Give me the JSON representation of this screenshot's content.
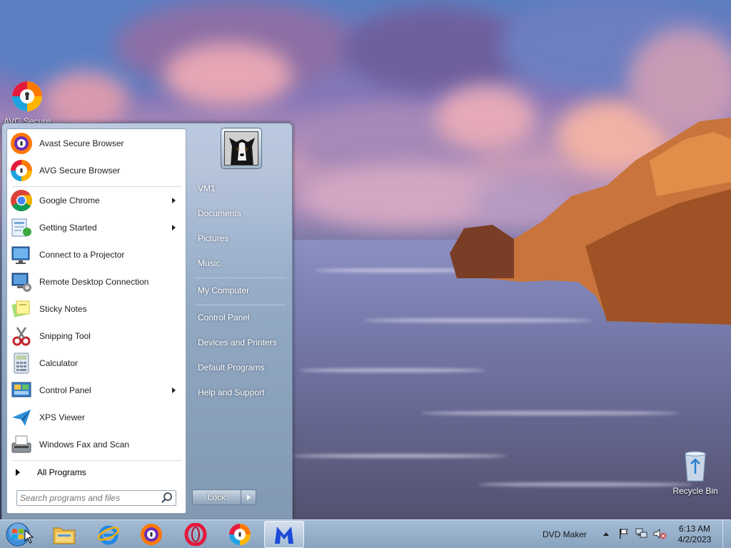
{
  "desktop": {
    "icons": [
      {
        "label": "AVG Secure"
      },
      {
        "label": "Recycle Bin"
      }
    ]
  },
  "start_menu": {
    "pinned_programs": [
      {
        "label": "Avast Secure Browser",
        "icon": "avast-browser-icon",
        "submenu": false
      },
      {
        "label": "AVG Secure Browser",
        "icon": "avg-browser-icon",
        "submenu": false
      }
    ],
    "recent_programs": [
      {
        "label": "Google Chrome",
        "icon": "chrome-icon",
        "submenu": true
      },
      {
        "label": "Getting Started",
        "icon": "getting-started-icon",
        "submenu": true
      },
      {
        "label": "Connect to a Projector",
        "icon": "projector-icon",
        "submenu": false
      },
      {
        "label": "Remote Desktop Connection",
        "icon": "remote-desktop-icon",
        "submenu": false
      },
      {
        "label": "Sticky Notes",
        "icon": "sticky-notes-icon",
        "submenu": false
      },
      {
        "label": "Snipping Tool",
        "icon": "snipping-tool-icon",
        "submenu": false
      },
      {
        "label": "Calculator",
        "icon": "calculator-icon",
        "submenu": false
      },
      {
        "label": "Control Panel",
        "icon": "control-panel-icon",
        "submenu": true
      },
      {
        "label": "XPS Viewer",
        "icon": "xps-viewer-icon",
        "submenu": false
      },
      {
        "label": "Windows Fax and Scan",
        "icon": "fax-scan-icon",
        "submenu": false
      }
    ],
    "all_programs_label": "All Programs",
    "search_placeholder": "Search programs and files",
    "right_links": [
      {
        "label": "VM1"
      },
      {
        "label": "Documents"
      },
      {
        "label": "Pictures"
      },
      {
        "label": "Music"
      },
      {
        "label": "My Computer"
      },
      {
        "label": "Control Panel"
      },
      {
        "label": "Devices and Printers"
      },
      {
        "label": "Default Programs"
      },
      {
        "label": "Help and Support"
      }
    ],
    "lock_label": "Lock"
  },
  "taskbar": {
    "items": [
      {
        "icon": "start-orb-icon"
      },
      {
        "icon": "file-explorer-icon"
      },
      {
        "icon": "internet-explorer-icon"
      },
      {
        "icon": "avast-browser-icon"
      },
      {
        "icon": "opera-icon"
      },
      {
        "icon": "avg-browser-icon"
      },
      {
        "icon": "malwarebytes-icon"
      }
    ],
    "tray_label": "DVD Maker",
    "time": "6:13 AM",
    "date": "4/2/2023"
  },
  "colors": {
    "avast_orange": "#ff7800",
    "avast_purple": "#6b2fb5",
    "chrome_red": "#db4437",
    "chrome_yellow": "#f4b400",
    "chrome_green": "#0f9d58",
    "chrome_blue": "#4285f4",
    "malwarebytes_blue": "#1d4bd8",
    "opera_red": "#e6173a"
  }
}
